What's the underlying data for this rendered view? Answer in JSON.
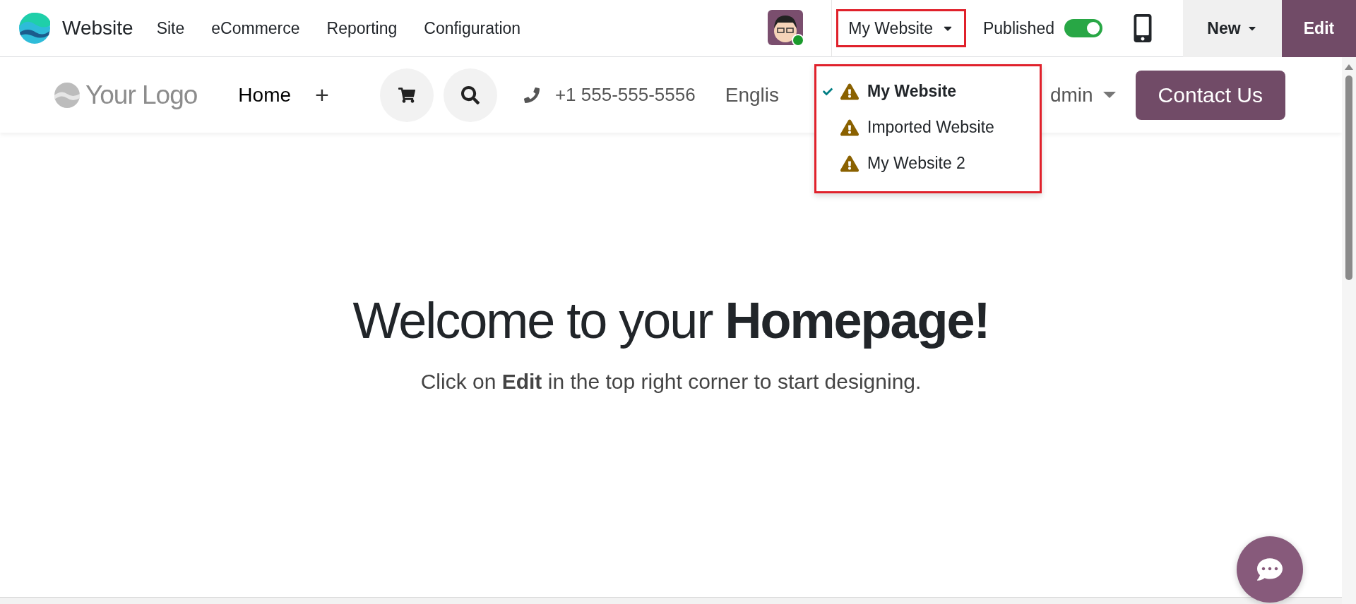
{
  "top_bar": {
    "app_name": "Website",
    "menu": [
      "Site",
      "eCommerce",
      "Reporting",
      "Configuration"
    ],
    "website_switcher": "My Website",
    "published": {
      "label": "Published",
      "on": true
    },
    "new_button": "New",
    "edit_button": "Edit"
  },
  "website_menu": {
    "items": [
      {
        "label": "My Website",
        "selected": true
      },
      {
        "label": "Imported Website",
        "selected": false
      },
      {
        "label": "My Website 2",
        "selected": false
      }
    ]
  },
  "site_header": {
    "logo": "Your Logo",
    "links": [
      "Home"
    ],
    "add": "+",
    "phone": "+1 555-555-5556",
    "language": "Englis",
    "user": "dmin",
    "contact_button": "Contact Us"
  },
  "hero": {
    "heading": "Welcome to your **Homepage!**",
    "subtitle": "Click on **Edit** in the top right corner to start designing."
  }
}
